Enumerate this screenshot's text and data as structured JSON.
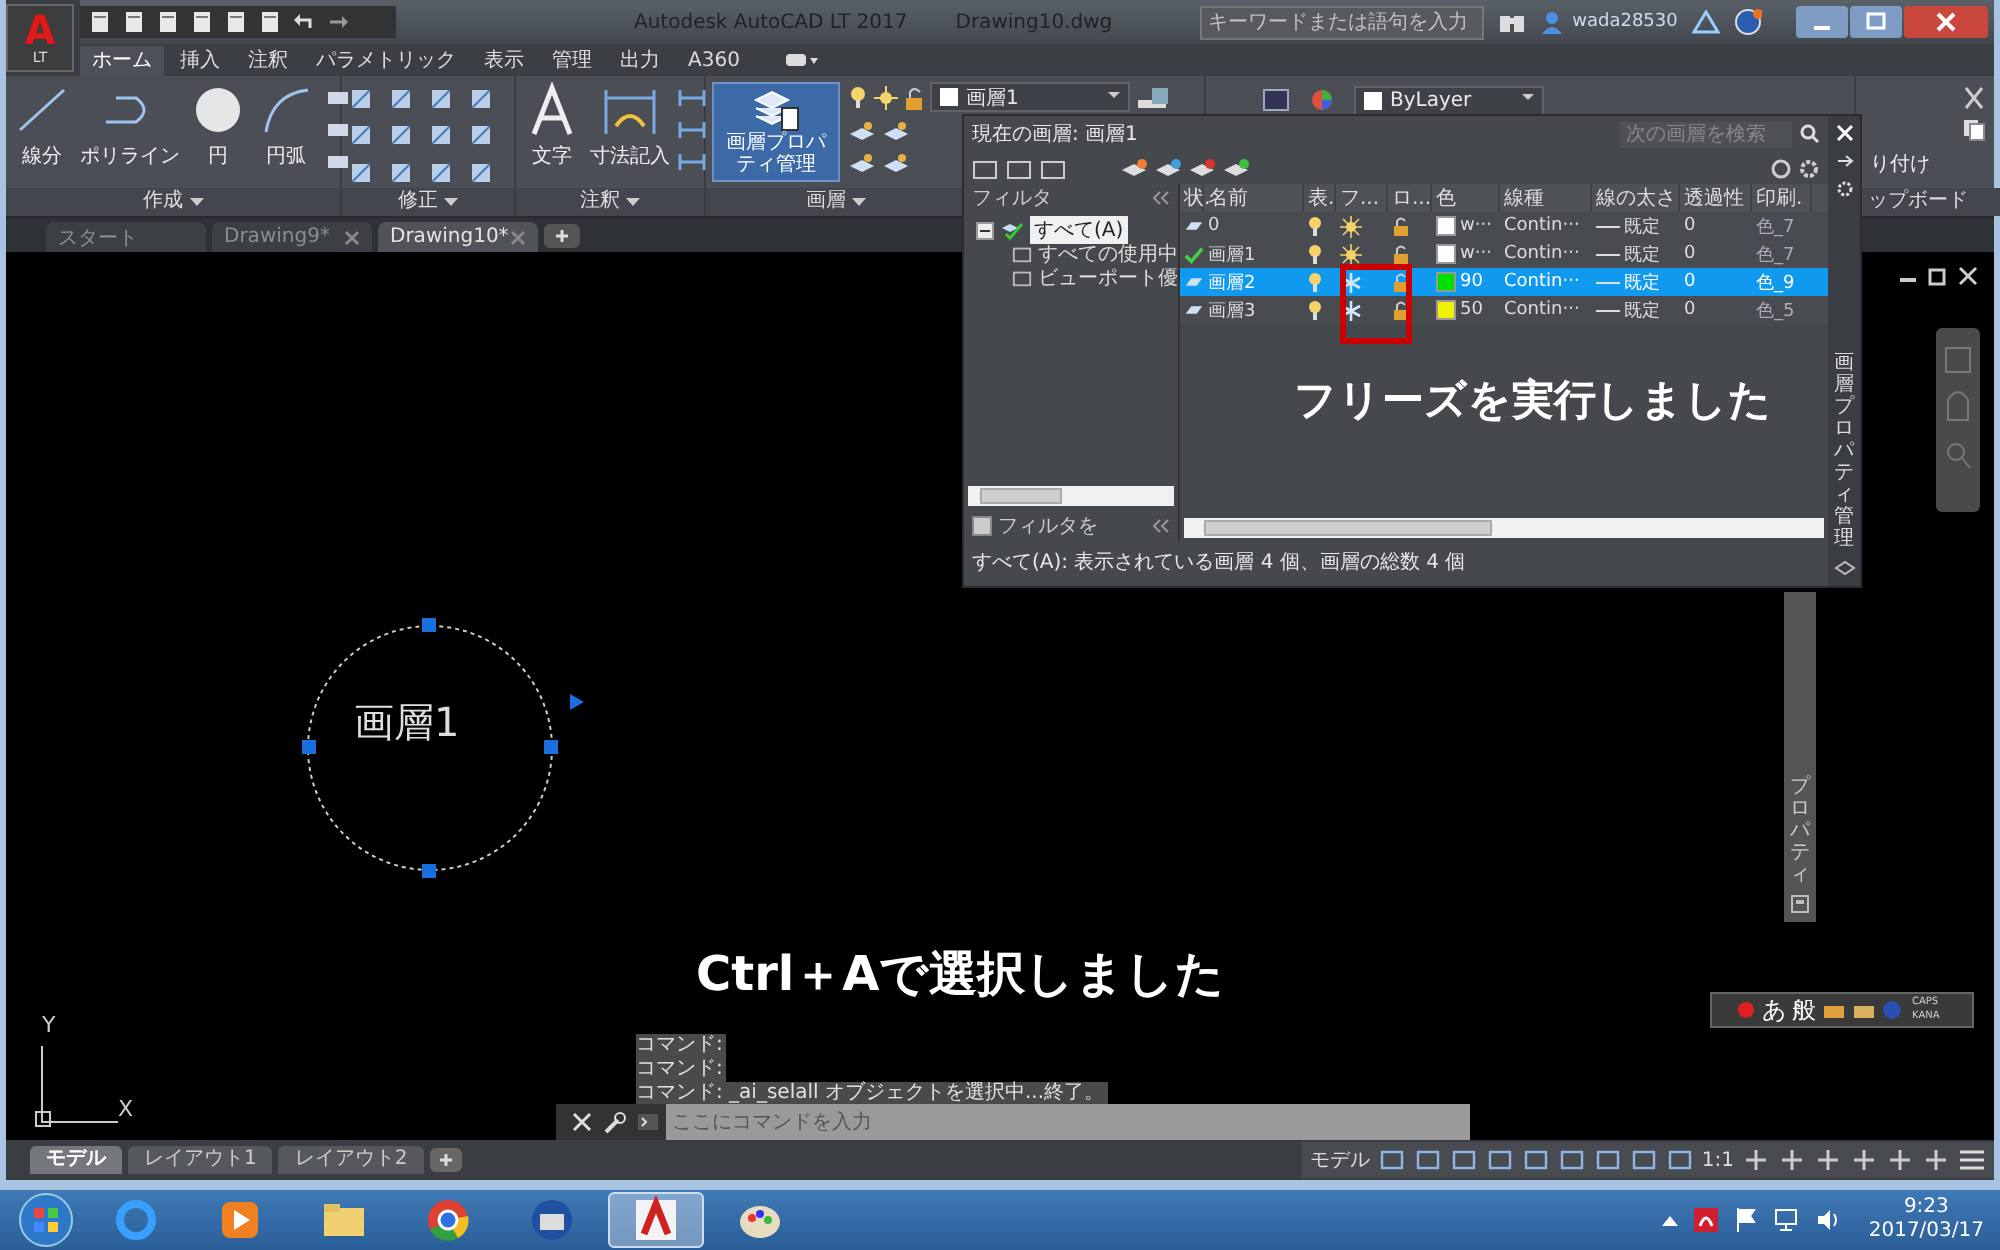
{
  "window": {
    "logo": "A",
    "edition": "LT",
    "title": "Autodesk AutoCAD LT 2017",
    "file": "Drawing10.dwg",
    "search_placeholder": "キーワードまたは語句を入力",
    "user": "wada28530"
  },
  "ribbon_tabs": [
    {
      "label": "ホーム",
      "selected": true
    },
    {
      "label": "挿入",
      "selected": false
    },
    {
      "label": "注釈",
      "selected": false
    },
    {
      "label": "パラメトリック",
      "selected": false
    },
    {
      "label": "表示",
      "selected": false
    },
    {
      "label": "管理",
      "selected": false
    },
    {
      "label": "出力",
      "selected": false
    },
    {
      "label": "A360",
      "selected": false
    }
  ],
  "ribbon": {
    "draw": {
      "title": "作成",
      "tools": [
        {
          "label": "線分",
          "kind": "line"
        },
        {
          "label": "ポリライン",
          "kind": "polyline"
        },
        {
          "label": "円",
          "kind": "circle"
        },
        {
          "label": "円弧",
          "kind": "arc"
        }
      ]
    },
    "modify": {
      "title": "修正"
    },
    "annotate": {
      "title": "注釈",
      "tools": [
        {
          "label": "文字",
          "kind": "text"
        },
        {
          "label": "寸法記入",
          "kind": "dimension"
        }
      ]
    },
    "layers": {
      "title": "画層",
      "button": "画層プロパティ管理",
      "current_layer": "画層1"
    },
    "properties": {
      "color_setting": "ByLayer"
    },
    "clipboard": {
      "button": "り付け",
      "title": "ップボード"
    }
  },
  "doc_tabs": [
    {
      "label": "スタート",
      "selected": false,
      "closable": false
    },
    {
      "label": "Drawing9*",
      "selected": false,
      "closable": true
    },
    {
      "label": "Drawing10*",
      "selected": true,
      "closable": true
    }
  ],
  "canvas": {
    "circle_label": "画層1",
    "note": "Ctrl＋Aで選択しました",
    "axis_y": "Y",
    "axis_x": "X",
    "history": [
      "コマンド:",
      "コマンド:",
      "コマンド:  _ai_selall オブジェクトを選択中...終了。"
    ],
    "command_placeholder": "ここにコマンドを入力",
    "properties_title": "プロパティ",
    "ime": {
      "mode": "あ",
      "dictionary": "般",
      "caps": "CAPS",
      "kana": "KANA"
    }
  },
  "layout_tabs": [
    {
      "label": "モデル",
      "selected": true
    },
    {
      "label": "レイアウト1",
      "selected": false
    },
    {
      "label": "レイアウト2",
      "selected": false
    }
  ],
  "status_bar": {
    "space": "モデル",
    "scale": "1:1"
  },
  "layer_palette": {
    "title": "画層プロパティ管理",
    "current": "現在の画層: 画層1",
    "search_placeholder": "次の画層を検索",
    "filter_header": "フィルタ",
    "filter_tree": [
      {
        "label": "すべて(A)",
        "selected": true,
        "children": [
          {
            "label": "すべての使用中",
            "selected": false
          },
          {
            "label": "ビューポート優",
            "selected": false
          }
        ]
      }
    ],
    "invert_filter": {
      "label": "フィルタを",
      "checked": false
    },
    "columns": [
      "状.",
      "名前",
      "表.",
      "フ...",
      "ロ...",
      "色",
      "線種",
      "線の太さ",
      "透過性",
      "印刷."
    ],
    "layers": [
      {
        "name": "0",
        "current": false,
        "on": true,
        "frozen": false,
        "locked": false,
        "color": "#ffffff",
        "color_name": "w···",
        "linetype": "Contin···",
        "lineweight": "既定",
        "transparency": "0",
        "plot_style": "色_7",
        "selected": false
      },
      {
        "name": "画層1",
        "current": true,
        "on": true,
        "frozen": false,
        "locked": false,
        "color": "#ffffff",
        "color_name": "w···",
        "linetype": "Contin···",
        "lineweight": "既定",
        "transparency": "0",
        "plot_style": "色_7",
        "selected": false
      },
      {
        "name": "画層2",
        "current": false,
        "on": true,
        "frozen": true,
        "locked": false,
        "color": "#00e000",
        "color_name": "90",
        "linetype": "Contin···",
        "lineweight": "既定",
        "transparency": "0",
        "plot_style": "色_9",
        "selected": true
      },
      {
        "name": "画層3",
        "current": false,
        "on": true,
        "frozen": true,
        "locked": false,
        "color": "#f0f000",
        "color_name": "50",
        "linetype": "Contin···",
        "lineweight": "既定",
        "transparency": "0",
        "plot_style": "色_5",
        "selected": false
      }
    ],
    "summary": "すべて(A): 表示されている画層 4 個、画層の総数 4 個",
    "note": "フリーズを実行しました"
  },
  "taskbar": {
    "apps": [
      {
        "kind": "ie",
        "selected": false
      },
      {
        "kind": "media",
        "selected": false
      },
      {
        "kind": "explorer",
        "selected": false
      },
      {
        "kind": "chrome",
        "selected": false
      },
      {
        "kind": "mail",
        "selected": false
      },
      {
        "kind": "autocad",
        "selected": true
      },
      {
        "kind": "paint",
        "selected": false
      }
    ],
    "time": "9:23",
    "date": "2017/03/17"
  }
}
